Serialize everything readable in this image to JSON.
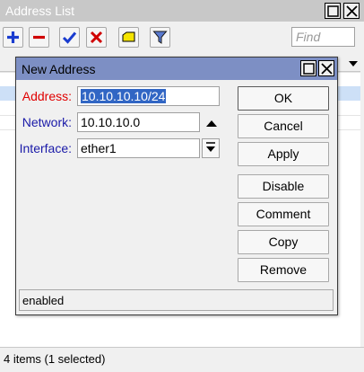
{
  "background_window": {
    "title": "Address List",
    "find_placeholder": "Find",
    "status": "4 items (1 selected)",
    "toolbar": [
      {
        "name": "add-button",
        "icon": "plus-icon",
        "color": "#1a3ccf"
      },
      {
        "name": "remove-button",
        "icon": "minus-icon",
        "color": "#d00000"
      },
      {
        "name": "enable-button",
        "icon": "check-icon",
        "color": "#1a3ccf"
      },
      {
        "name": "disable-button",
        "icon": "x-icon",
        "color": "#d00000"
      },
      {
        "name": "comment-button",
        "icon": "note-icon",
        "color": "#f5e400"
      },
      {
        "name": "filter-button",
        "icon": "filter-icon",
        "color": "#5a7ad0"
      }
    ]
  },
  "dialog": {
    "title": "New Address",
    "fields": {
      "address": {
        "label": "Address:",
        "value": "10.10.10.10/24"
      },
      "network": {
        "label": "Network:",
        "value": "10.10.10.0"
      },
      "interface": {
        "label": "Interface:",
        "value": "ether1"
      }
    },
    "buttons": {
      "ok": "OK",
      "cancel": "Cancel",
      "apply": "Apply",
      "disable": "Disable",
      "comment": "Comment",
      "copy": "Copy",
      "remove": "Remove"
    },
    "status": "enabled"
  },
  "colors": {
    "dialog_title_bar": "#7d8fc4",
    "required_label": "#e00000",
    "optional_label": "#1a1aa8",
    "selection": "#3166c4"
  }
}
